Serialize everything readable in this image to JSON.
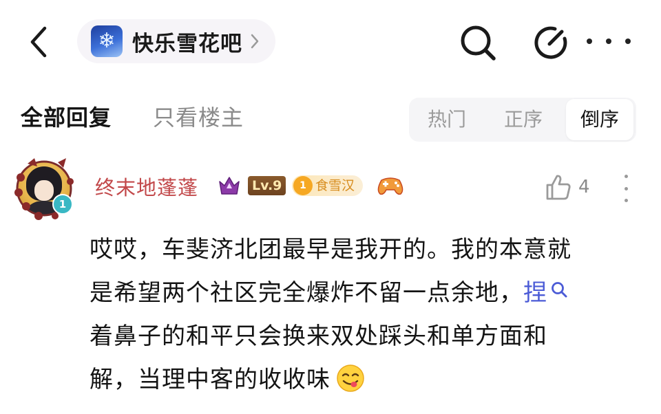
{
  "header": {
    "forum_name": "快乐雪花吧",
    "back_icon": "chevron-left-icon",
    "search_icon": "search-icon",
    "edit_icon": "edit-icon",
    "more_icon": "more-horizontal-icon"
  },
  "filter": {
    "tab_all": "全部回复",
    "tab_op_only": "只看楼主",
    "sort_options": [
      "热门",
      "正序",
      "倒序"
    ],
    "selected_sort": "倒序"
  },
  "comment": {
    "username": "终末地蓬蓬",
    "avatar_badge": "1",
    "level": "Lv.9",
    "title_badge_number": "1",
    "title_badge": "食雪汉",
    "like_count": "4",
    "content_lines": [
      "哎哎，车斐济北团最早是我开的。我的本意就",
      "是希望两个社区完全爆炸不留一点余地，",
      "着鼻子的和平只会换来双处踩头和单方面和",
      "解，当理中客的收收味"
    ],
    "linked_word": "捏",
    "emoji": "yum-face-emoji"
  },
  "colors": {
    "username": "#c2484a",
    "link": "#4b5bd6",
    "muted": "#8a8a8a",
    "sort_bg": "#f5f5f7"
  }
}
